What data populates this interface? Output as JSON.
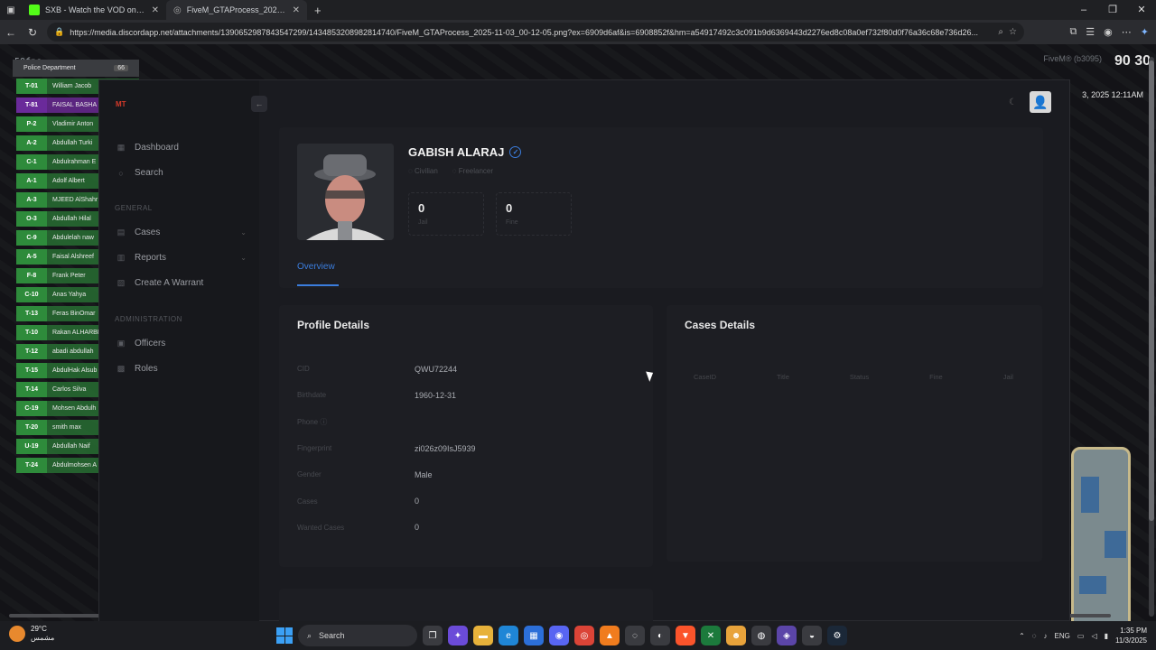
{
  "browser": {
    "tabs": [
      {
        "title": "SXB - Watch the VOD on Kick",
        "active": false
      },
      {
        "title": "FiveM_GTAProcess_2025-11-03_0",
        "active": true
      }
    ],
    "new_tab": "+",
    "url": "https://media.discordapp.net/attachments/1390652987843547299/1434853208982814740/FiveM_GTAProcess_2025-11-03_00-12-05.png?ex=6909d6af&is=6908852f&hm=a54917492c3c091b9d6369443d2276ed8c08a0ef732f80d0f76a36c68e736d26..."
  },
  "game": {
    "fps": "50fps",
    "hud_right": "90 30",
    "fivem": "FiveM® (b3095)",
    "date": "3, 2025 12:11AM",
    "roster_title": "Police Department",
    "roster_count": "66",
    "roster": [
      {
        "code": "T-01",
        "name": "William Jacob",
        "color": "green"
      },
      {
        "code": "T-81",
        "name": "FAISAL BASHA",
        "color": "purple"
      },
      {
        "code": "P-2",
        "name": "Vladimir Anton",
        "color": "green"
      },
      {
        "code": "A-2",
        "name": "Abdullah Turki",
        "color": "green"
      },
      {
        "code": "C-1",
        "name": "Abdulrahman E",
        "color": "green"
      },
      {
        "code": "A-1",
        "name": "Adolf Albert",
        "color": "green"
      },
      {
        "code": "A-3",
        "name": "MJEED AlShahr",
        "color": "green"
      },
      {
        "code": "O-3",
        "name": "Abdullah Hilal",
        "color": "green"
      },
      {
        "code": "C-9",
        "name": "Abdulelah naw",
        "color": "green"
      },
      {
        "code": "A-5",
        "name": "Faisal Alshreef",
        "color": "green"
      },
      {
        "code": "F-8",
        "name": "Frank Peter",
        "color": "green"
      },
      {
        "code": "C-10",
        "name": "Anas Yahya",
        "color": "green"
      },
      {
        "code": "T-13",
        "name": "Feras BinOmar",
        "color": "green"
      },
      {
        "code": "T-10",
        "name": "Rakan ALHARBI",
        "color": "green"
      },
      {
        "code": "T-12",
        "name": "abadi abdullah",
        "color": "green"
      },
      {
        "code": "T-15",
        "name": "AbdulHak Alsub",
        "color": "green"
      },
      {
        "code": "T-14",
        "name": "Carlos Silva",
        "color": "green"
      },
      {
        "code": "C-19",
        "name": "Mohsen Abdulh",
        "color": "green"
      },
      {
        "code": "T-20",
        "name": "smith max",
        "color": "green"
      },
      {
        "code": "U-19",
        "name": "Abdullah Naif",
        "color": "green"
      },
      {
        "code": "T-24",
        "name": "Abdulmohsen A",
        "color": "green"
      }
    ]
  },
  "mdt": {
    "logo": "MT",
    "collapse": "←",
    "nav": {
      "dashboard": "Dashboard",
      "search": "Search",
      "general_header": "GENERAL",
      "cases": "Cases",
      "reports": "Reports",
      "create_warrant": "Create A Warrant",
      "admin_header": "ADMINISTRATION",
      "officers": "Officers",
      "roles": "Roles"
    },
    "profile": {
      "name": "GABISH ALARAJ",
      "tag_role": "Civilian",
      "tag_job": "Freelancer",
      "jail_value": "0",
      "jail_label": "Jail",
      "fine_value": "0",
      "fine_label": "Fine",
      "tab_overview": "Overview"
    },
    "profile_details": {
      "title": "Profile Details",
      "rows": [
        {
          "k": "CID",
          "v": "QWU72244"
        },
        {
          "k": "Birthdate",
          "v": "1960-12-31"
        },
        {
          "k": "Phone",
          "v": ""
        },
        {
          "k": "Fingerprint",
          "v": "zi026z09IsJ5939"
        },
        {
          "k": "Gender",
          "v": "Male"
        },
        {
          "k": "Cases",
          "v": "0"
        },
        {
          "k": "Wanted Cases",
          "v": "0"
        }
      ]
    },
    "cases_details": {
      "title": "Cases Details",
      "columns": [
        "CaseID",
        "Title",
        "Status",
        "Fine",
        "Jail"
      ]
    }
  },
  "taskbar": {
    "temp": "29°C",
    "weather_sub": "مشمس",
    "search": "Search",
    "lang": "ENG",
    "time": "1:35 PM",
    "date": "11/3/2025"
  },
  "colors": {
    "accent": "#3b7ddd",
    "roster_green": "#2e8b3b",
    "roster_purple": "#6a2a9a"
  }
}
